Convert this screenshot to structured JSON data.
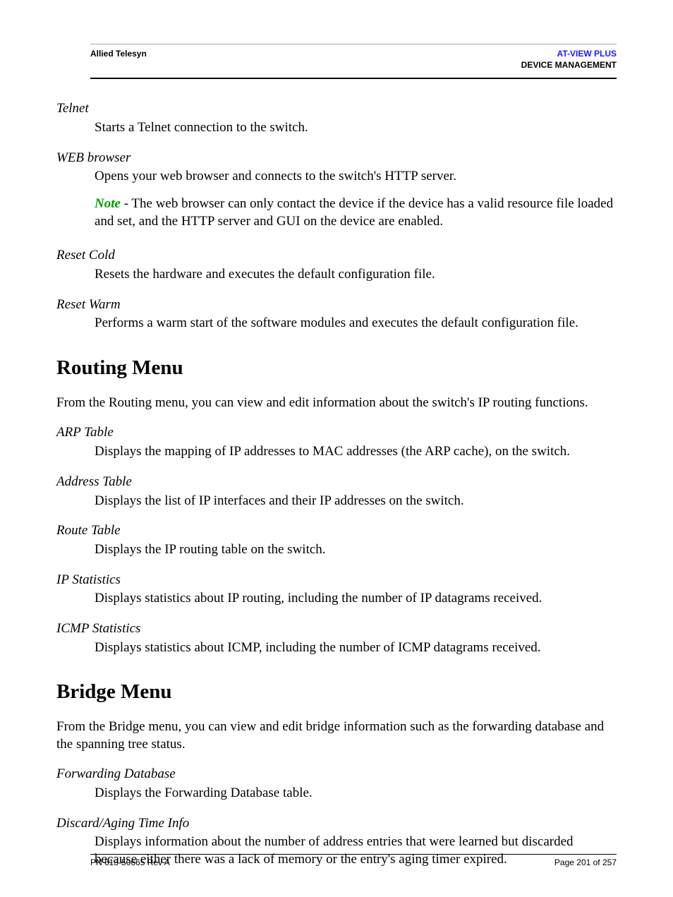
{
  "header": {
    "left": "Allied Telesyn",
    "right_line1": "AT-VIEW PLUS",
    "right_line2": "DEVICE MANAGEMENT"
  },
  "section1": {
    "items": [
      {
        "term": "Telnet",
        "desc": "Starts a Telnet connection to the switch."
      },
      {
        "term": "WEB browser",
        "desc": "Opens your web browser and connects to the switch's HTTP server.",
        "note_label": "Note",
        "note_text": " - The web browser can only contact the device if the device has a valid resource file loaded and set, and the HTTP server and GUI on the device are enabled."
      },
      {
        "term": "Reset Cold",
        "desc": "Resets the hardware and executes the default configuration file."
      },
      {
        "term": "Reset Warm",
        "desc": "Performs a warm start of the software modules and executes the default configuration file."
      }
    ]
  },
  "section2": {
    "heading": "Routing Menu",
    "intro": "From the Routing menu, you can view and edit information about the switch's IP routing functions.",
    "items": [
      {
        "term": "ARP Table",
        "desc": "Displays the mapping of IP addresses to MAC addresses (the ARP cache), on the switch."
      },
      {
        "term": "Address Table",
        "desc": "Displays the list of IP interfaces and their IP addresses on the switch."
      },
      {
        "term": "Route Table",
        "desc": "Displays the IP routing table on the switch."
      },
      {
        "term": "IP Statistics",
        "desc": "Displays statistics about IP routing, including the number of IP datagrams received."
      },
      {
        "term": "ICMP Statistics",
        "desc": "Displays statistics about ICMP, including the number of ICMP datagrams received."
      }
    ]
  },
  "section3": {
    "heading": "Bridge Menu",
    "intro": "From the Bridge menu, you can view and edit bridge information such as the forwarding database and the spanning tree status.",
    "items": [
      {
        "term": "Forwarding Database",
        "desc": "Displays the Forwarding Database table."
      },
      {
        "term": "Discard/Aging Time Info",
        "desc": "Displays information about the number of address entries that were learned but discarded because either there was a lack of memory or the entry's aging timer expired."
      }
    ]
  },
  "footer": {
    "left": "PN 613-50665 Rev A",
    "right": "Page 201 of 257"
  }
}
